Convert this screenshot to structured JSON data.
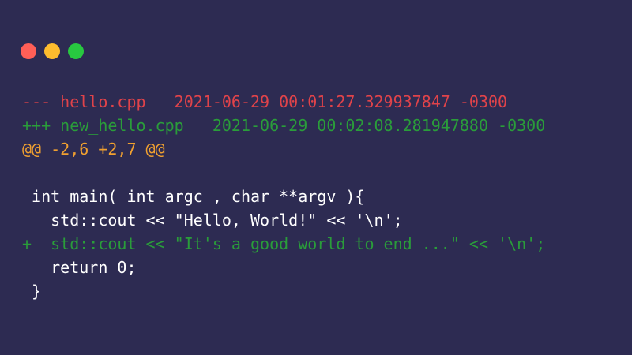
{
  "colors": {
    "background": "#2d2b52",
    "close": "#ff5f57",
    "minimize": "#febc2e",
    "maximize": "#28c840",
    "removed": "#e0434a",
    "added": "#2a9d3a",
    "hunk": "#f0a030",
    "context": "#ffffff"
  },
  "window_controls": [
    {
      "name": "close",
      "color": "#ff5f57"
    },
    {
      "name": "minimize",
      "color": "#febc2e"
    },
    {
      "name": "maximize",
      "color": "#28c840"
    }
  ],
  "diff": {
    "lines": [
      {
        "type": "old-header",
        "segments": [
          {
            "text": "--- hello.cpp   2021-06-29 00:01:27.329937847 -0300",
            "color": "#e0434a"
          }
        ]
      },
      {
        "type": "new-header",
        "segments": [
          {
            "text": "+++ new_hello.cpp   2021-06-29 00:02:08.281947880 -0300",
            "color": "#2a9d3a"
          }
        ]
      },
      {
        "type": "hunk",
        "segments": [
          {
            "text": "@@ -2,6 +2,7 @@",
            "color": "#f0a030"
          }
        ]
      },
      {
        "type": "blank",
        "segments": [
          {
            "text": "",
            "color": "#ffffff"
          }
        ]
      },
      {
        "type": "context",
        "segments": [
          {
            "text": " int main( int argc , char **argv ){",
            "color": "#ffffff"
          }
        ]
      },
      {
        "type": "context",
        "segments": [
          {
            "text": "   std::cout << ",
            "color": "#ffffff"
          },
          {
            "text": "\"Hello, World!\"",
            "color": "#ffffff"
          },
          {
            "text": " << '\\n';",
            "color": "#ffffff"
          }
        ]
      },
      {
        "type": "added",
        "segments": [
          {
            "text": "+  std::cout << \"It's a good world to end ...\" << '\\n';",
            "color": "#2a9d3a"
          }
        ]
      },
      {
        "type": "context",
        "segments": [
          {
            "text": "   return 0;",
            "color": "#ffffff"
          }
        ]
      },
      {
        "type": "context",
        "segments": [
          {
            "text": " }",
            "color": "#ffffff"
          }
        ]
      }
    ]
  }
}
